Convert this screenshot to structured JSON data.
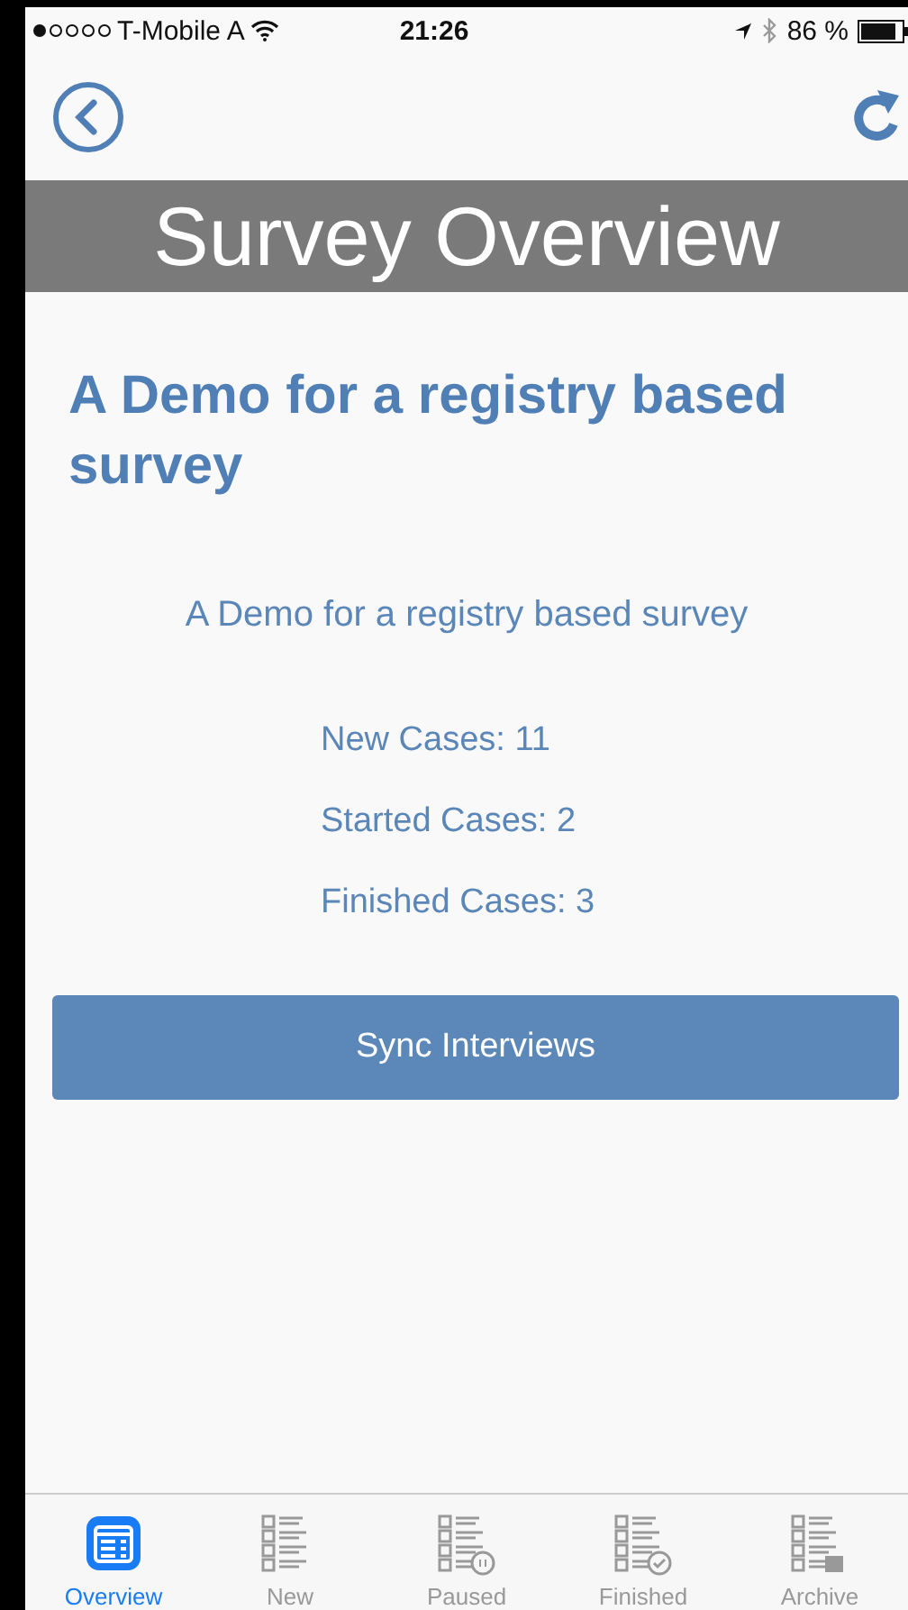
{
  "status_bar": {
    "carrier": "T-Mobile A",
    "time": "21:26",
    "battery": "86 %"
  },
  "title": "Survey Overview",
  "survey": {
    "name": "A Demo for a registry based survey",
    "description": "A Demo for a registry based survey"
  },
  "stats": [
    "New Cases: 11",
    "Started Cases: 2",
    "Finished Cases: 3"
  ],
  "sync_button": "Sync Interviews",
  "tabs": [
    {
      "label": "Overview",
      "kind": "overview",
      "selected": true
    },
    {
      "label": "New",
      "kind": "new",
      "selected": false
    },
    {
      "label": "Paused",
      "kind": "paused",
      "selected": false
    },
    {
      "label": "Finished",
      "kind": "finished",
      "selected": false
    },
    {
      "label": "Archive",
      "kind": "archive",
      "selected": false
    }
  ]
}
